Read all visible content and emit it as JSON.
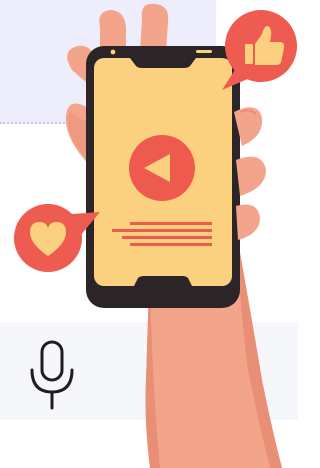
{
  "illustration": {
    "subject": "",
    "icons": [
      "play-icon",
      "thumbs-up-icon",
      "heart-icon",
      "microphone-icon"
    ]
  },
  "colors": {
    "skin": "#f3a58c",
    "skin_shadow": "#e88f76",
    "phone_body": "#2b2528",
    "screen": "#fbd180",
    "accent_red": "#ef5a4f",
    "bubble_red": "#ee5b50",
    "icon_cream": "#fbd180",
    "panel_lavender": "#eeedfb",
    "panel_gray": "#f6f7fa",
    "mic_stroke": "#1e1e1e"
  }
}
